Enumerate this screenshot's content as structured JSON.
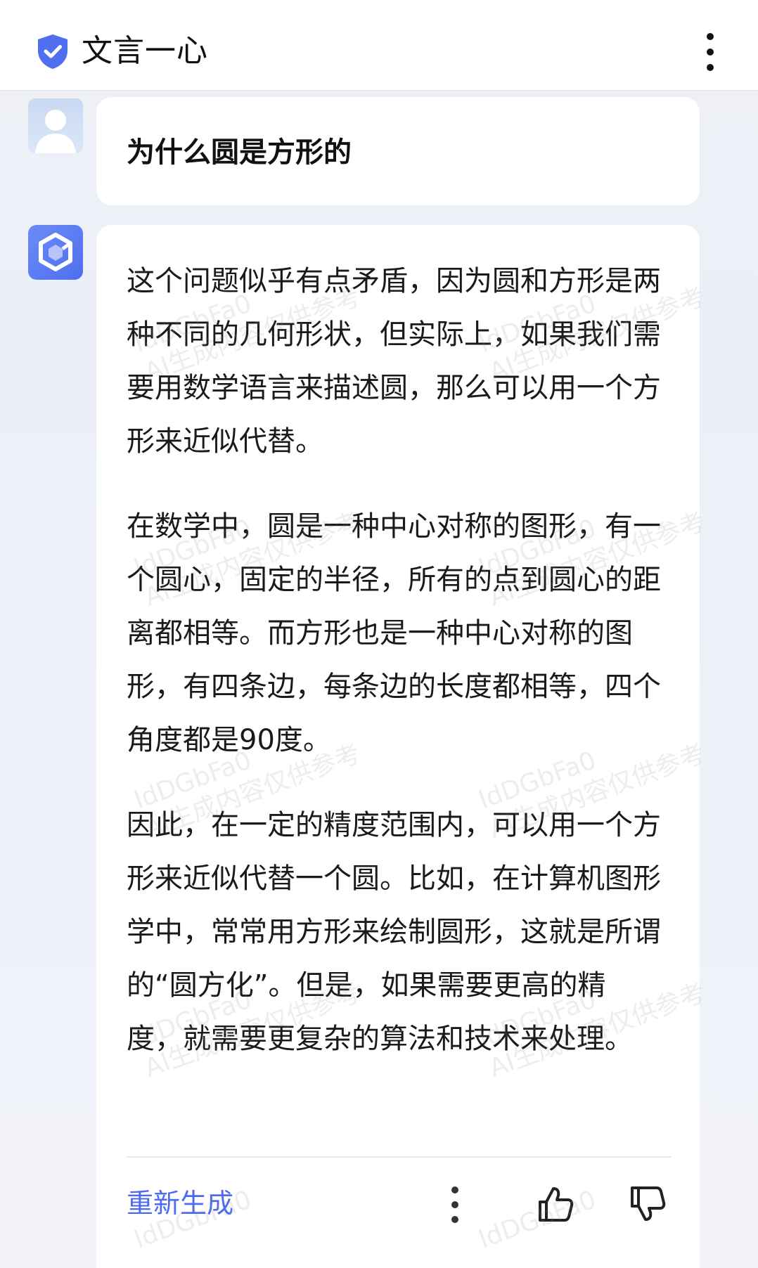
{
  "header": {
    "title": "文言一心",
    "shield_icon": "shield-check-icon",
    "more_icon": "more-vertical-icon"
  },
  "conversation": {
    "user_message": "为什么圆是方形的",
    "bot_paragraphs": [
      "这个问题似乎有点矛盾，因为圆和方形是两种不同的几何形状，但实际上，如果我们需要用数学语言来描述圆，那么可以用一个方形来近似代替。",
      "在数学中，圆是一种中心对称的图形，有一个圆心，固定的半径，所有的点到圆心的距离都相等。而方形也是一种中心对称的图形，有四条边，每条边的长度都相等，四个角度都是90度。",
      "因此，在一定的精度范围内，可以用一个方形来近似代替一个圆。比如，在计算机图形学中，常常用方形来绘制圆形，这就是所谓的“圆方化”。但是，如果需要更高的精度，就需要更复杂的算法和技术来处理。"
    ]
  },
  "actions": {
    "regenerate_label": "重新生成"
  },
  "watermark": {
    "line1": "IdDGbFa0",
    "line2": "AI生成内容仅供参考"
  },
  "colors": {
    "accent": "#4d6bef",
    "shield": "#4f6ef0",
    "bot_avatar": "#5a7bf3",
    "background": "#eef0f6"
  }
}
